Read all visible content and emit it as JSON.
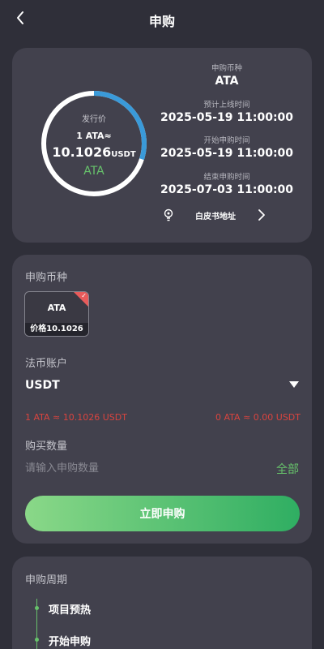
{
  "header": {
    "title": "申购"
  },
  "issue": {
    "label": "发行价",
    "rate": "1 ATA≈",
    "price": "10.1026",
    "unit": "USDT",
    "coin": "ATA",
    "progress_fraction": 0.3
  },
  "info": {
    "coin_label": "申购币种",
    "coin_value": "ATA",
    "listing_label": "预计上线时间",
    "listing_value": "2025-05-19 11:00:00",
    "start_label": "开始申购时间",
    "start_value": "2025-05-19 11:00:00",
    "end_label": "结束申购时间",
    "end_value": "2025-07-03 11:00:00"
  },
  "whitepaper": {
    "label": "白皮书地址",
    "icon": "lightbulb-icon"
  },
  "subscribe": {
    "coin_section_label": "申购币种",
    "tile": {
      "name": "ATA",
      "price": "价格10.1026"
    },
    "account_label": "法币账户",
    "account_value": "USDT",
    "rate_left": "1 ATA ≈ 10.1026 USDT",
    "rate_right": "0 ATA ≈ 0.00 USDT",
    "qty_label": "购买数量",
    "qty_placeholder": "请输入申购数量",
    "all_label": "全部",
    "submit_label": "立即申购"
  },
  "period": {
    "title": "申购周期",
    "steps": [
      "项目预热",
      "开始申购"
    ]
  },
  "colors": {
    "background": "#2f2f39",
    "card": "#42414d",
    "accent_green": "#67c26b",
    "accent_blue": "#3a9ad9",
    "warning_red": "#d9443f"
  }
}
